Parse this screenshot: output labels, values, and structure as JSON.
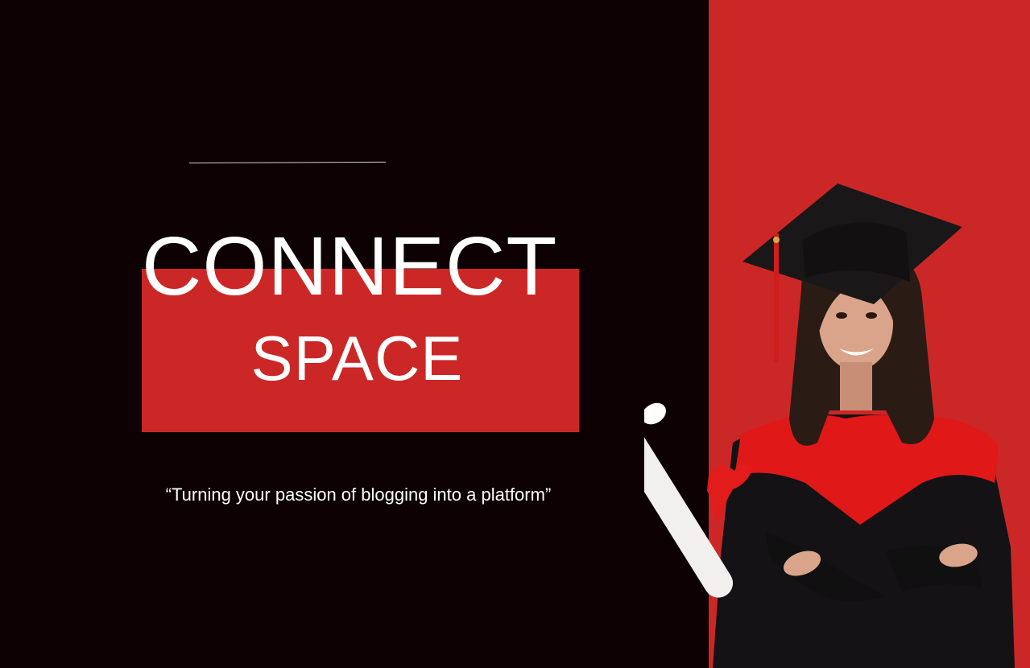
{
  "hero": {
    "title": "CONNECT",
    "subtitle": "SPACE",
    "tagline": "“Turning your passion of blogging into a platform”"
  },
  "colors": {
    "background": "#0d0103",
    "accent": "#cc2727",
    "text": "#ffffff"
  },
  "image": {
    "subject": "graduate-student-with-diploma"
  }
}
